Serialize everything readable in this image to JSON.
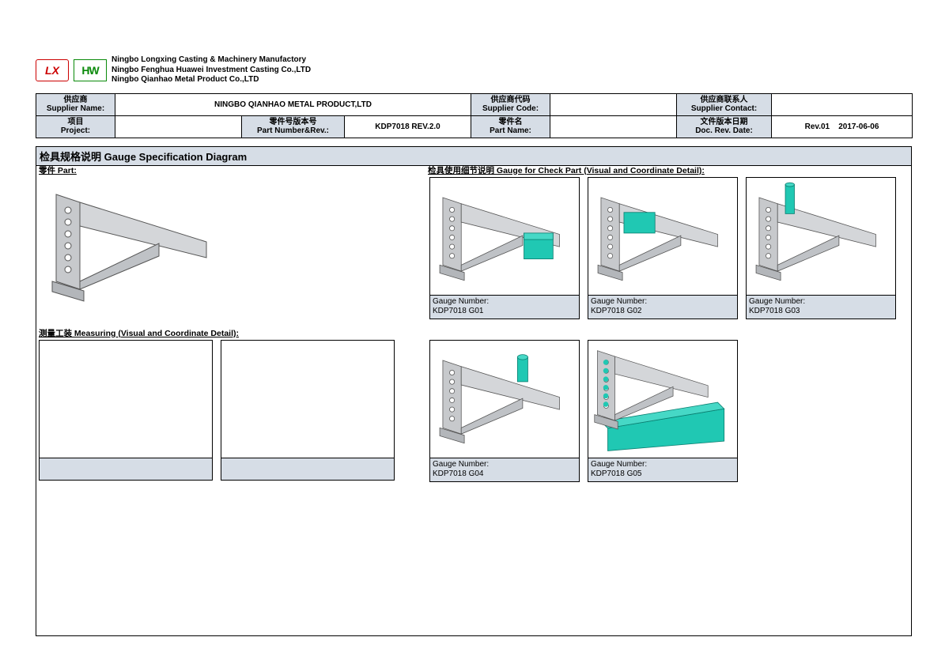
{
  "company": {
    "line1": "Ningbo Longxing Casting & Machinery Manufactory",
    "line2": "Ningbo Fenghua Huawei Investment Casting Co.,LTD",
    "line3": "Ningbo Qianhao Metal Product Co.,LTD"
  },
  "header": {
    "supplier_name_lbl_cn": "供应商",
    "supplier_name_lbl_en": "Supplier Name:",
    "supplier_name_val": "NINGBO QIANHAO METAL PRODUCT,LTD",
    "supplier_code_lbl_cn": "供应商代码",
    "supplier_code_lbl_en": "Supplier Code:",
    "supplier_code_val": "",
    "supplier_contact_lbl_cn": "供应商联系人",
    "supplier_contact_lbl_en": "Supplier Contact:",
    "supplier_contact_val": "",
    "project_lbl_cn": "项目",
    "project_lbl_en": "Project:",
    "project_val": "",
    "partnum_lbl_cn": "零件号版本号",
    "partnum_lbl_en": "Part Number&Rev.:",
    "partnum_val": "KDP7018 REV.2.0",
    "partname_lbl_cn": "零件名",
    "partname_lbl_en": "Part Name:",
    "partname_val": "",
    "docrev_lbl_cn": "文件版本日期",
    "docrev_lbl_en": "Doc. Rev. Date:",
    "docrev_rev": "Rev.01",
    "docrev_date": "2017-06-06"
  },
  "section": {
    "title": "检具规格说明 Gauge Specification Diagram",
    "part_label": "零件 Part:",
    "gauge_label": "检具使用细节说明 Gauge for Check Part (Visual and Coordinate Detail):",
    "measuring_label": "测量工装 Measuring (Visual and Coordinate Detail):"
  },
  "gauges": {
    "gn_label": "Gauge Number:",
    "g01": "KDP7018 G01",
    "g02": "KDP7018 G02",
    "g03": "KDP7018 G03",
    "g04": "KDP7018 G04",
    "g05": "KDP7018 G05"
  },
  "colors": {
    "accent": "#20c8b3",
    "metal": "#c7c9cc",
    "metal_dark": "#9a9ea3",
    "header_bg": "#d6dde6"
  }
}
